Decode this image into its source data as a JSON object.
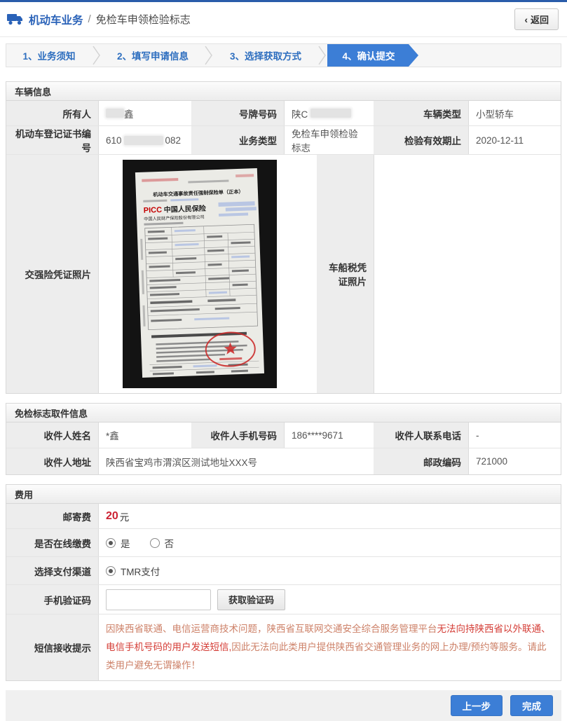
{
  "colors": {
    "accent_blue": "#3c7ed6",
    "topline_blue": "#2a5caa",
    "title_blue": "#2a62b8",
    "price_red": "#cc2233",
    "tip_light": "#cd8168",
    "tip_strong": "#d43c35"
  },
  "page": {
    "title_primary": "机动车业务",
    "title_separator": "/",
    "title_secondary": "免检车申领检验标志",
    "back_chevron": "‹",
    "back_label": "返回"
  },
  "steps": [
    {
      "label": "1、业务须知",
      "state": "done"
    },
    {
      "label": "2、填写申请信息",
      "state": "done"
    },
    {
      "label": "3、选择获取方式",
      "state": "done"
    },
    {
      "label": "4、确认提交",
      "state": "active"
    }
  ],
  "vehicle_section": {
    "title": "车辆信息",
    "owner_label": "所有人",
    "owner_value": "鑫",
    "plate_label": "号牌号码",
    "plate_value": "陕C",
    "vehicle_type_label": "车辆类型",
    "vehicle_type_value": "小型轿车",
    "cert_label": "机动车登记证书编号",
    "cert_prefix": "610",
    "cert_suffix": "082",
    "biz_type_label": "业务类型",
    "biz_type_value": "免检车申领检验标志",
    "valid_until_label": "检验有效期止",
    "valid_until_value": "2020-12-11",
    "insurance_photo_label": "交强险凭证照片",
    "tax_photo_label": "车船税凭证照片"
  },
  "photo_doc": {
    "title": "机动车交通事故责任强制保险单（正本）",
    "brand": "PICC",
    "brand_cn": "中国人民保险",
    "company": "中国人民财产保险股份有限公司"
  },
  "pickup_section": {
    "title": "免检标志取件信息",
    "name_label": "收件人姓名",
    "name_value": "*鑫",
    "mobile_label": "收件人手机号码",
    "mobile_value": "186****9671",
    "phone_label": "收件人联系电话",
    "phone_value": "-",
    "address_label": "收件人地址",
    "address_value": "陕西省宝鸡市渭滨区测试地址XXX号",
    "postcode_label": "邮政编码",
    "postcode_value": "721000"
  },
  "fee_section": {
    "title": "费用",
    "postage_label": "邮寄费",
    "postage_amount": "20",
    "postage_unit": "元",
    "online_pay_label": "是否在线缴费",
    "online_pay_yes": "是",
    "online_pay_no": "否",
    "channel_label": "选择支付渠道",
    "channel_option": "TMR支付",
    "sms_code_label": "手机验证码",
    "get_code_button": "获取验证码",
    "sms_tip_label": "短信接收提示",
    "tip_part1": "因陕西省联通、电信运营商技术问题，陕西省互联网交通安全综合服务管理平台",
    "tip_part2": "无法向持陕西省以外联通、电信手机号码的用户发送短信,",
    "tip_part3": "因此无法向此类用户提供陕西省交通管理业务的网上办理/预约等服务。请此类用户避免无谓操作！"
  },
  "footer": {
    "prev_button": "上一步",
    "finish_button": "完成"
  }
}
